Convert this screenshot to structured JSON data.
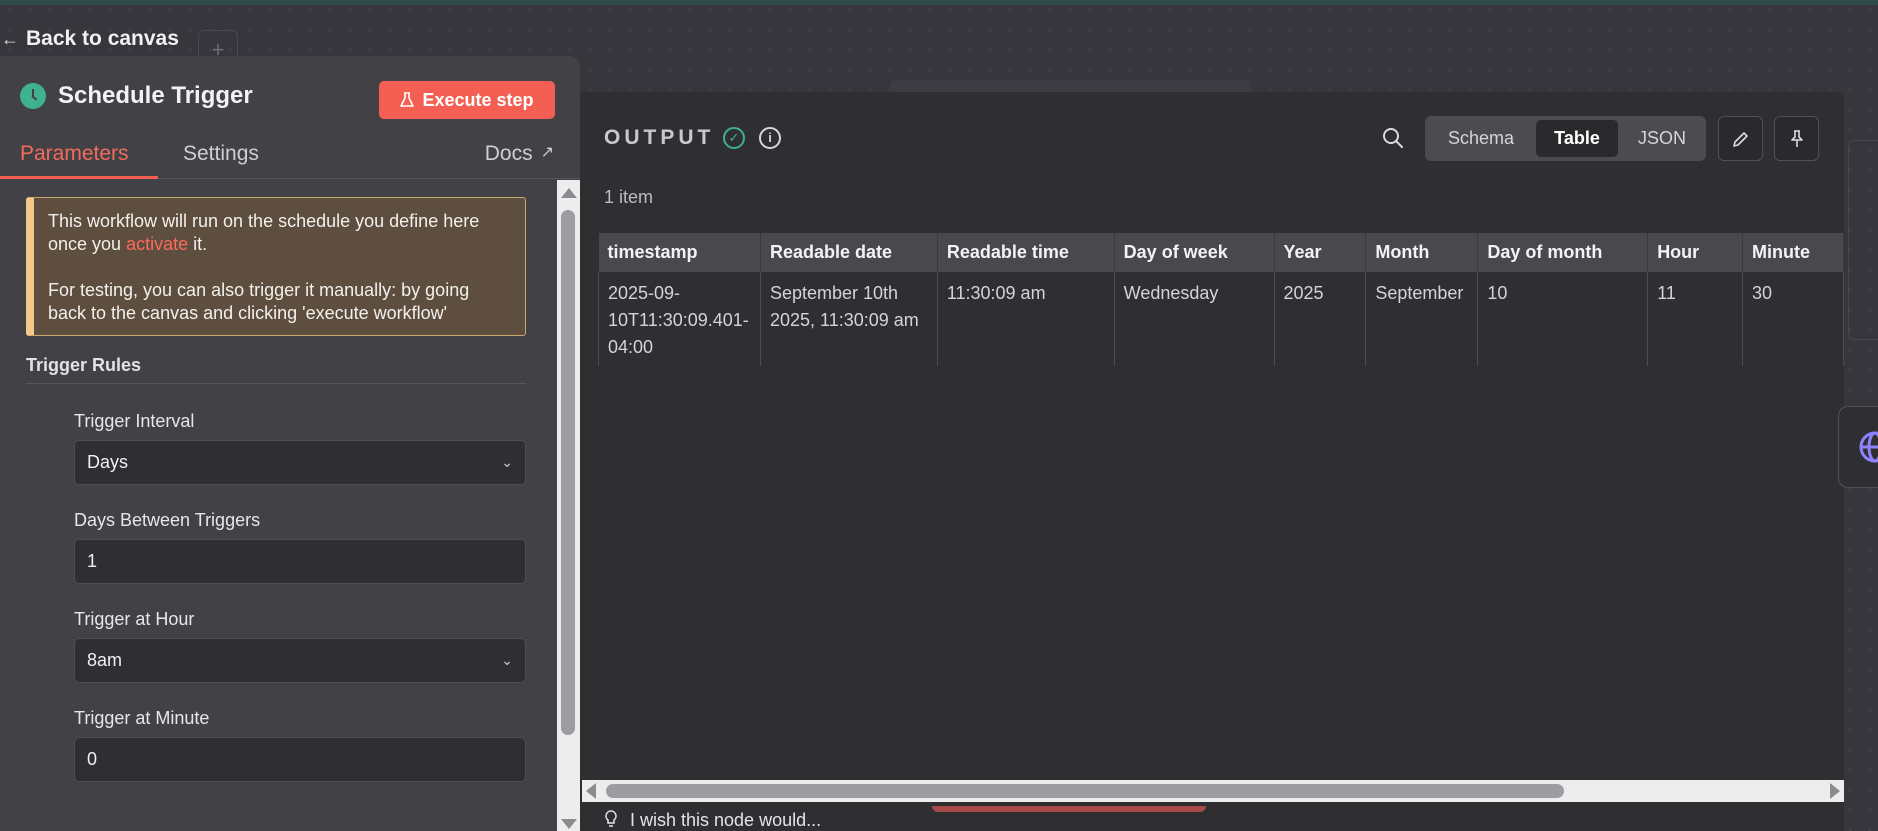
{
  "navigation": {
    "back_label": "Back to canvas"
  },
  "node": {
    "title": "Schedule Trigger",
    "execute_label": "Execute step",
    "tabs": {
      "parameters": "Parameters",
      "settings": "Settings",
      "docs": "Docs"
    }
  },
  "notice": {
    "line1_before": "This workflow will run on the schedule you define here once you ",
    "activate_link": "activate",
    "line1_after": " it.",
    "line2": "For testing, you can also trigger it manually: by going back to the canvas and clicking 'execute workflow'"
  },
  "trigger_rules": {
    "section_title": "Trigger Rules",
    "interval_label": "Trigger Interval",
    "interval_value": "Days",
    "days_between_label": "Days Between Triggers",
    "days_between_value": "1",
    "hour_label": "Trigger at Hour",
    "hour_value": "8am",
    "minute_label": "Trigger at Minute",
    "minute_value": "0"
  },
  "output": {
    "title": "OUTPUT",
    "views": {
      "schema": "Schema",
      "table": "Table",
      "json": "JSON"
    },
    "active_view": "Table",
    "item_count": "1 item",
    "columns": [
      "timestamp",
      "Readable date",
      "Readable time",
      "Day of week",
      "Year",
      "Month",
      "Day of month",
      "Hour",
      "Minute"
    ],
    "rows": [
      [
        "2025-09-10T11:30:09.401-04:00",
        "September 10th 2025, 11:30:09 am",
        "11:30:09 am",
        "Wednesday",
        "2025",
        "September",
        "10",
        "11",
        "30"
      ]
    ]
  },
  "feedback": {
    "placeholder": "I wish this node would..."
  },
  "colors": {
    "accent": "#f35f53",
    "success": "#3fb18f",
    "notice_bg": "#5d4e3f"
  }
}
